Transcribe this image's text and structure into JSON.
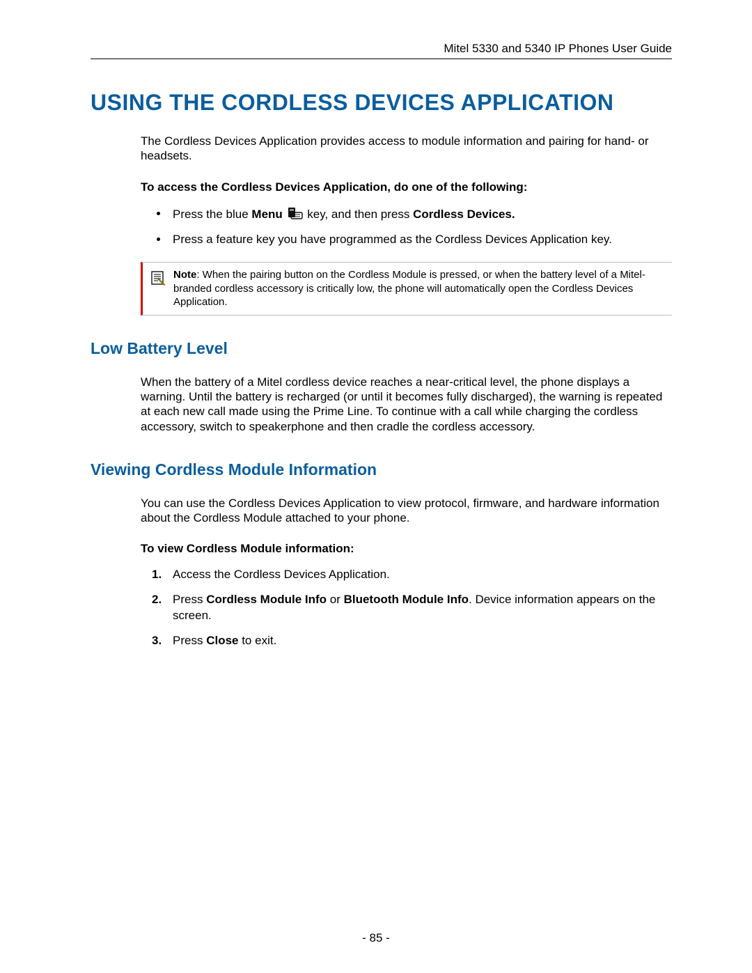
{
  "header": {
    "running_title": "Mitel 5330 and 5340 IP Phones User Guide"
  },
  "title": "USING THE CORDLESS DEVICES APPLICATION",
  "intro": "The Cordless Devices Application provides access to module information and pairing for hand- or headsets.",
  "access_lead": "To access the Cordless Devices Application, do one of the following:",
  "bullets": {
    "b1_pre": "Press the blue ",
    "b1_menu": "Menu",
    "b1_post": " key, and then press ",
    "b1_cordless": "Cordless Devices.",
    "b2": "Press a feature key you have programmed as the Cordless Devices Application key."
  },
  "note": {
    "label": "Note",
    "text": ": When the pairing button on the Cordless Module is pressed, or when the battery level of a Mitel-branded cordless accessory is critically low, the phone will automatically open the Cordless Devices Application."
  },
  "sections": {
    "low_battery": {
      "heading": "Low Battery Level",
      "body": "When the battery of a Mitel cordless device reaches a near-critical level, the phone displays a warning. Until the battery is recharged (or until it becomes fully discharged), the warning is repeated at each new call made using the Prime Line. To continue with a call while charging the cordless accessory, switch to speakerphone and then cradle the cordless accessory."
    },
    "viewing": {
      "heading": "Viewing Cordless Module Information",
      "body": "You can use the Cordless Devices Application to view protocol, firmware, and hardware information about the Cordless Module attached to your phone.",
      "steps_lead": "To view Cordless Module information:",
      "step1": "Access the Cordless Devices Application.",
      "step2_pre": "Press ",
      "step2_b1": "Cordless Module Info",
      "step2_mid": " or ",
      "step2_b2": "Bluetooth Module Info",
      "step2_post": ". Device information appears on the screen.",
      "step3_pre": "Press ",
      "step3_b": "Close",
      "step3_post": " to exit."
    }
  },
  "footer": {
    "page_number": "- 85 -"
  }
}
